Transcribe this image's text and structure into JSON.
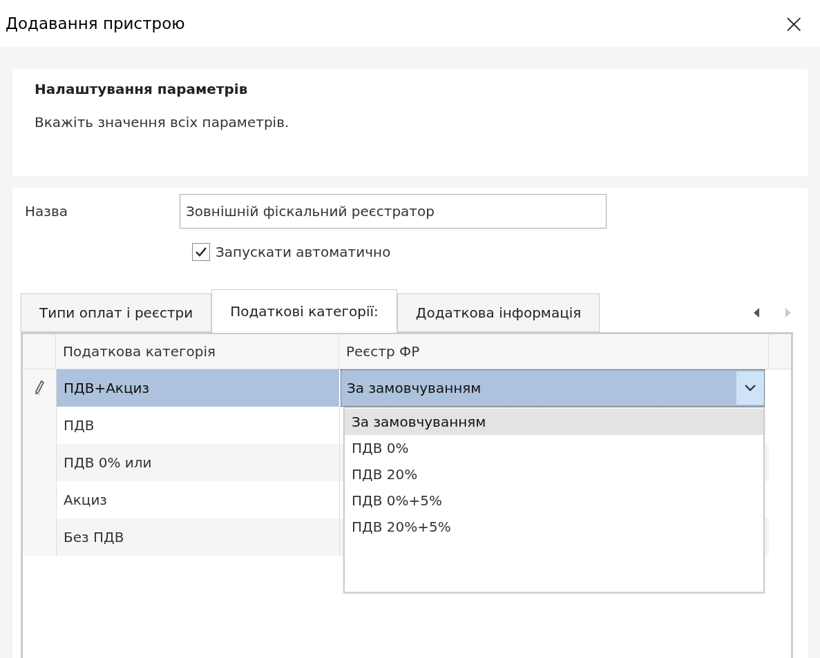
{
  "window": {
    "title": "Додавання пристрою",
    "close": "×"
  },
  "header": {
    "title": "Налаштування параметрів",
    "subtitle": "Вкажіть значення всіх параметрів."
  },
  "name_field": {
    "label": "Назва",
    "value": "Зовнішній фіскальний реєстратор"
  },
  "autostart": {
    "label": "Запускати автоматично",
    "checked": true
  },
  "tabs": [
    {
      "label": "Типи оплат і реєстри",
      "selected": false
    },
    {
      "label": "Податкові категорії:",
      "selected": true
    },
    {
      "label": "Додаткова інформація",
      "selected": false
    }
  ],
  "tab_scroll": {
    "left_disabled": false,
    "right_disabled": true
  },
  "table": {
    "columns": [
      "Податкова категорія",
      "Реєстр ФР"
    ],
    "rows": [
      {
        "category": "ПДВ+Акциз",
        "register": "За замовчуванням",
        "selected": true
      },
      {
        "category": "ПДВ",
        "selected": false
      },
      {
        "category": "ПДВ 0% или",
        "selected": false
      },
      {
        "category": "Акциз",
        "selected": false
      },
      {
        "category": "Без ПДВ",
        "selected": false
      }
    ]
  },
  "dropdown": {
    "options": [
      {
        "label": "За замовчуванням",
        "selected": true
      },
      {
        "label": "ПДВ 0%",
        "selected": false
      },
      {
        "label": "ПДВ 20%",
        "selected": false
      },
      {
        "label": "ПДВ 0%+5%",
        "selected": false
      },
      {
        "label": "ПДВ 20%+5%",
        "selected": false
      }
    ]
  }
}
